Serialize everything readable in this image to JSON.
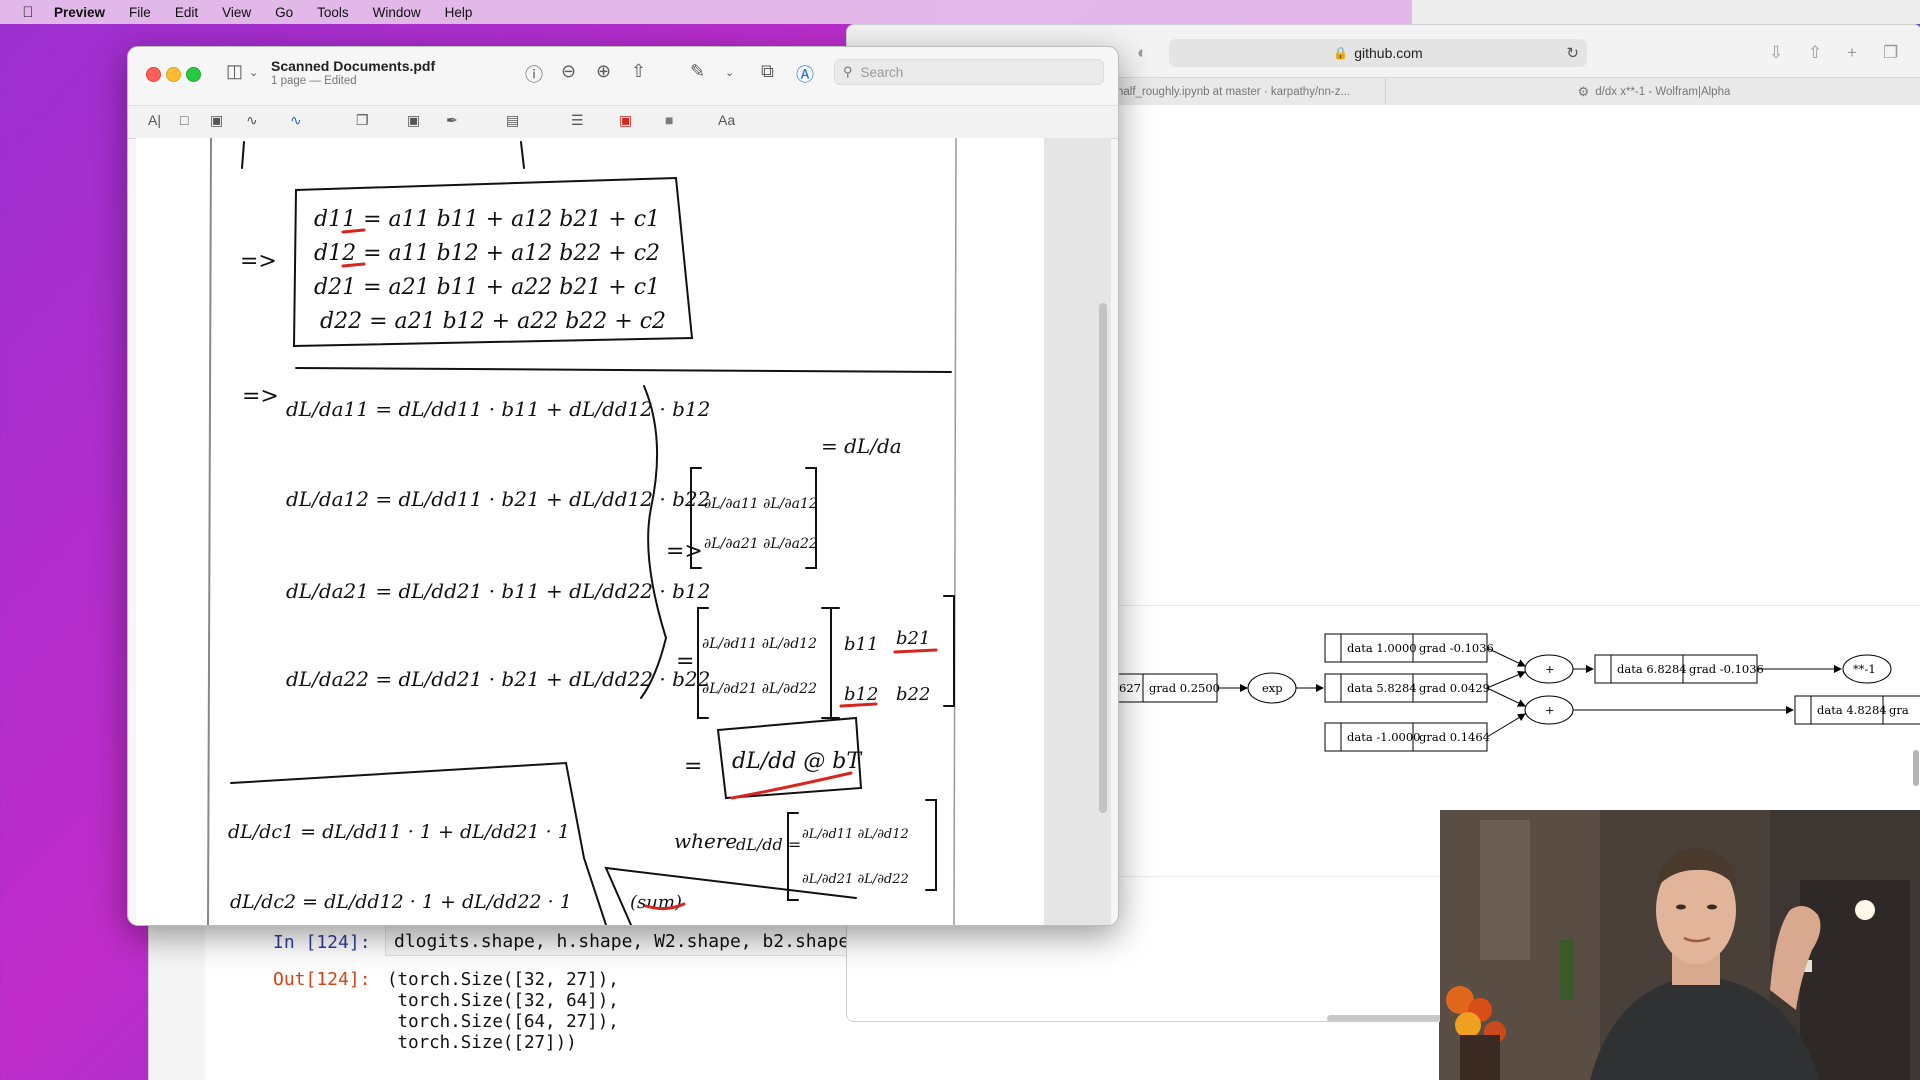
{
  "menubar": {
    "app_name": "Preview",
    "items": [
      "File",
      "Edit",
      "View",
      "Go",
      "Tools",
      "Window",
      "Help"
    ]
  },
  "jupyter": {
    "in_prompt": "In [124]:",
    "in_code": "dlogits.shape, h.shape, W2.shape, b2.shape",
    "out_prompt": "Out[124]:",
    "out_lines": [
      "(torch.Size([32, 27]),",
      " torch.Size([32, 64]),",
      " torch.Size([64, 27]),",
      " torch.Size([27]))"
    ]
  },
  "safari": {
    "address": "github.com",
    "tabs": [
      "half_roughly.ipynb at master · karpathy/nn-z...",
      "d/dx x**-1 - Wolfram|Alpha"
    ],
    "graph": {
      "nodes": [
        {
          "id": "n_left",
          "data": "627",
          "grad": "grad 0.2500"
        },
        {
          "id": "n_top",
          "data": "data 1.0000",
          "grad": "grad -0.1036"
        },
        {
          "id": "n_mid",
          "data": "data 5.8284",
          "grad": "grad 0.0429"
        },
        {
          "id": "n_bot",
          "data": "data -1.0000",
          "grad": "grad 0.1464"
        },
        {
          "id": "n_sum",
          "data": "data 6.8284",
          "grad": "grad -0.1036"
        },
        {
          "id": "n_right",
          "data": "data 4.8284",
          "grad": "gra"
        }
      ],
      "ops": [
        "exp",
        "+",
        "+",
        "**-1"
      ]
    }
  },
  "preview": {
    "title": "Scanned Documents.pdf",
    "subtitle": "1 page — Edited",
    "search_placeholder": "Search"
  },
  "handwriting": {
    "implies": "=>",
    "block1": [
      "d11 = a11 b11 + a12 b21 + c1",
      "d12 = a11 b12 + a12 b22 + c2",
      "d21 = a21 b11 + a22 b21 + c1",
      "d22 = a21 b12 + a22 b22 + c2"
    ],
    "partials": [
      "dL/da11 = dL/dd11 · b11 + dL/dd12 · b12",
      "dL/da12 = dL/dd11 · b21 + dL/dd12 · b22",
      "dL/da21 = dL/dd21 · b11 + dL/dd22 · b12",
      "dL/da22 = dL/dd21 · b21 + dL/dd22 · b22"
    ],
    "matrix_label": "= dL/da",
    "result": "dL/dd @ bT",
    "where": "where",
    "where_label": "dL/dd =",
    "c_partials": [
      "dL/dc1 = dL/dd11 · 1 + dL/dd21 · 1",
      "dL/dc2 = dL/dd12 · 1 + dL/dd22 · 1"
    ],
    "sum_note": "(sum)"
  },
  "colors": {
    "accent_red": "#d6261e",
    "ink": "#111111",
    "traffic_red": "#fe5f57",
    "traffic_yellow": "#febc2e",
    "traffic_green": "#28c840"
  }
}
